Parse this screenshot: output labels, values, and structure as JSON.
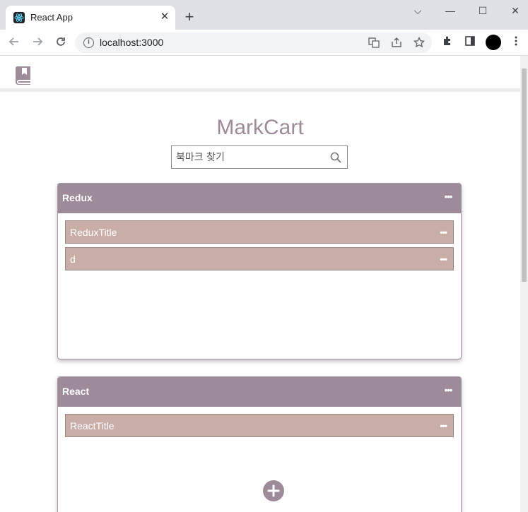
{
  "browser": {
    "tab_title": "React App",
    "tab_close": "✕",
    "new_tab": "+",
    "url": "localhost:3000",
    "window_buttons": {
      "tabsearch": "⌵",
      "minimize": "—",
      "maximize": "☐",
      "close": "✕"
    }
  },
  "app": {
    "brand": "MarkCart",
    "search_placeholder": "북마크 찾기",
    "colors": {
      "primary": "#9d8b9a",
      "item": "#c9ada7"
    },
    "categories": [
      {
        "title": "Redux",
        "bookmarks": [
          {
            "title": "ReduxTitle"
          },
          {
            "title": "d"
          }
        ]
      },
      {
        "title": "React",
        "bookmarks": [
          {
            "title": "ReactTitle"
          }
        ]
      }
    ]
  }
}
